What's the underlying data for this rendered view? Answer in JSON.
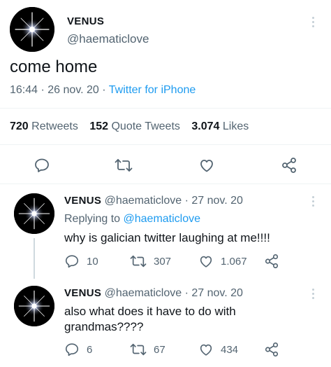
{
  "main": {
    "author_name": "VENUS",
    "author_handle": "@haematiclove",
    "text": "come home",
    "time": "16:44",
    "date": "26 nov. 20",
    "sep": "·",
    "client": "Twitter for iPhone",
    "stats": {
      "retweets_count": "720",
      "retweets_label": "Retweets",
      "quotes_count": "152",
      "quotes_label": "Quote Tweets",
      "likes_count": "3.074",
      "likes_label": "Likes"
    }
  },
  "replies": [
    {
      "author_name": "VENUS",
      "author_handle": "@haematiclove",
      "sep": "·",
      "date": "27 nov. 20",
      "replying_label": "Replying to",
      "replying_handle": "@haematiclove",
      "text": "why is galician twitter laughing at me!!!!",
      "replies": "10",
      "retweets": "307",
      "likes": "1.067"
    },
    {
      "author_name": "VENUS",
      "author_handle": "@haematiclove",
      "sep": "·",
      "date": "27 nov. 20",
      "text_line1": "also what does it have to do with",
      "text_line2": "grandmas????",
      "replies": "6",
      "retweets": "67",
      "likes": "434"
    }
  ],
  "icons": {
    "reply": "reply-icon",
    "retweet": "retweet-icon",
    "like": "heart-icon",
    "share": "share-icon",
    "more": "more-vertical-icon"
  },
  "colors": {
    "link": "#1d9bf0",
    "muted": "#536471",
    "text": "#0f1419",
    "divider": "#eff3f4"
  }
}
